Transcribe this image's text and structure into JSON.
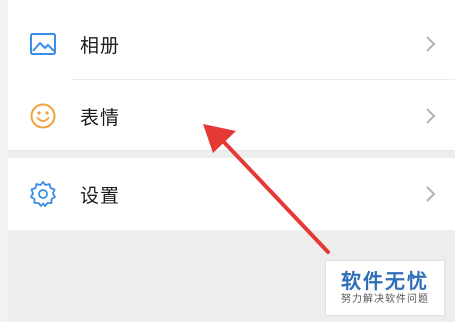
{
  "menu": {
    "items": [
      {
        "label": "相册",
        "icon": "photo-album-icon"
      },
      {
        "label": "表情",
        "icon": "smiley-face-icon"
      },
      {
        "label": "设置",
        "icon": "gear-icon"
      }
    ]
  },
  "watermark": {
    "title": "软件无忧",
    "subtitle": "努力解决软件问题"
  },
  "colors": {
    "album_icon": "#3b8ee8",
    "smiley_icon": "#f2a23a",
    "settings_icon": "#3b8ee8",
    "arrow": "#e53935",
    "watermark_text": "#2f6fb8"
  }
}
